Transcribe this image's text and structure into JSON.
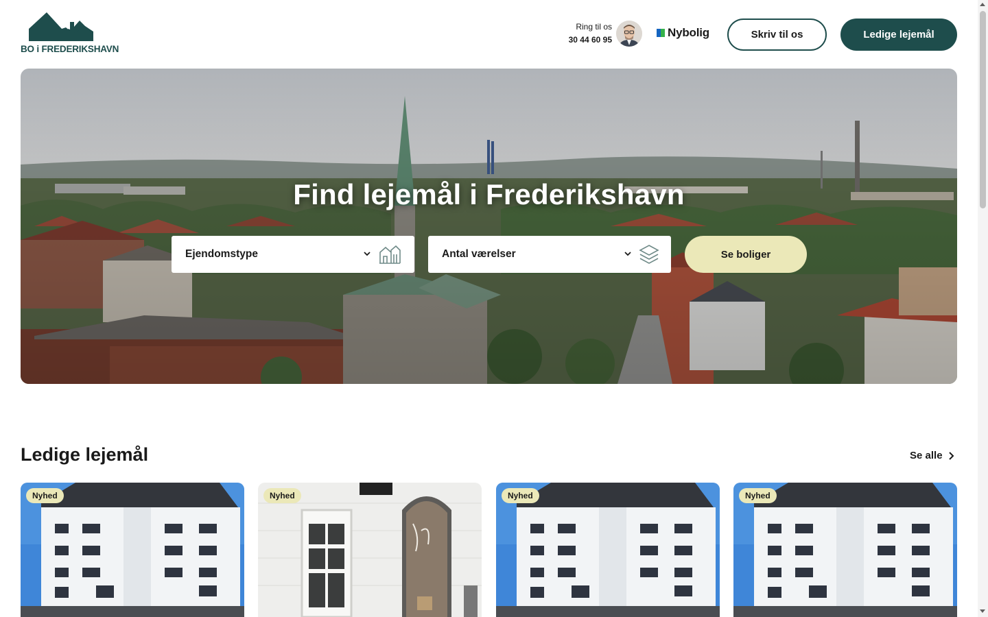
{
  "header": {
    "logo_text": "BO i FREDERIKSHAVN",
    "contact_label": "Ring til os",
    "contact_phone": "30 44 60 95",
    "partner_name": "Nybolig",
    "write_button": "Skriv til os",
    "available_button": "Ledige lejemål"
  },
  "hero": {
    "title": "Find lejemål i Frederikshavn",
    "property_type_placeholder": "Ejendomstype",
    "rooms_placeholder": "Antal værelser",
    "search_button": "Se boliger"
  },
  "listings": {
    "title": "Ledige lejemål",
    "see_all": "Se alle",
    "cards": [
      {
        "badge": "Nyhed",
        "image": "apartment-building"
      },
      {
        "badge": "Nyhed",
        "image": "shop-front"
      },
      {
        "badge": "Nyhed",
        "image": "apartment-building"
      },
      {
        "badge": "Nyhed",
        "image": "apartment-building"
      }
    ]
  },
  "colors": {
    "brand": "#1e4d4c",
    "accent": "#ebe8b8",
    "partner_blue": "#1565c0",
    "partner_green": "#35b24a"
  }
}
